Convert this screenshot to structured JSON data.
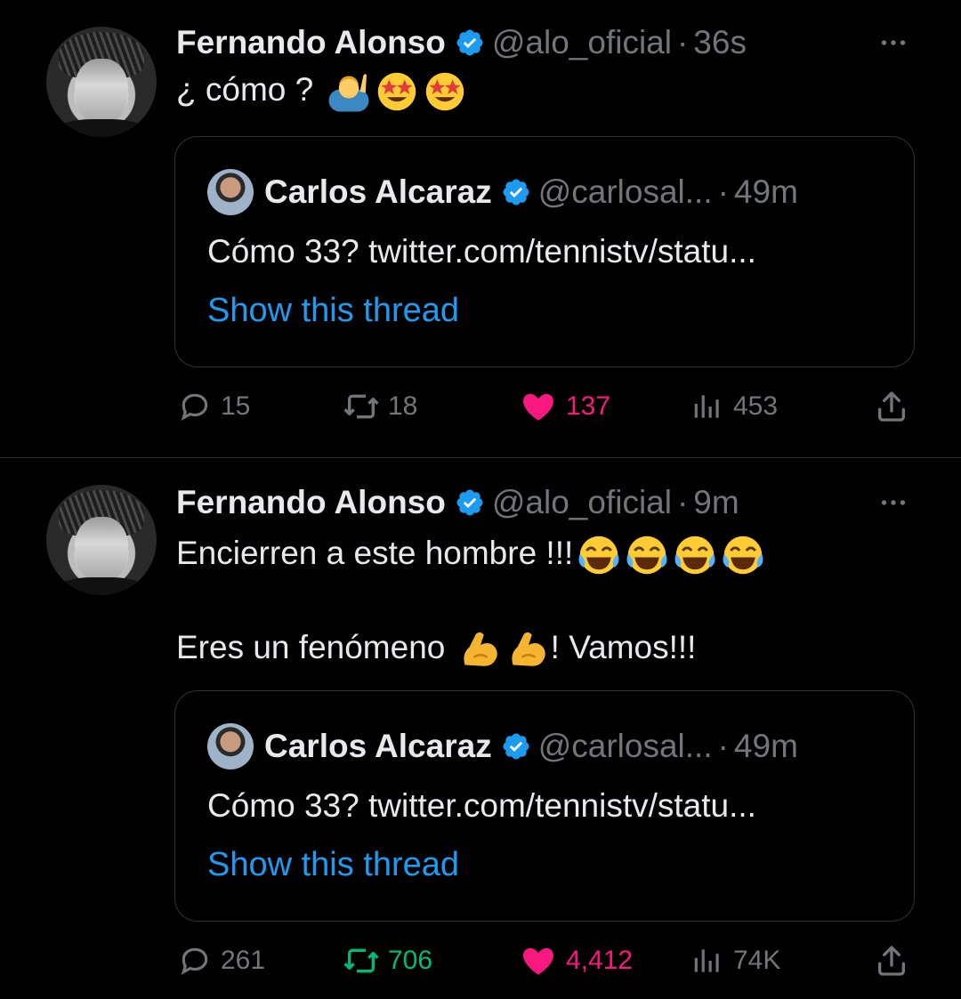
{
  "tweets": [
    {
      "author": "Fernando Alonso",
      "handle": "@alo_oficial",
      "separator": "·",
      "time": "36s",
      "lines": [
        "¿ cómo ?"
      ],
      "emojis": [
        "man-raising-hand-emoji",
        "star-struck-emoji",
        "star-struck-emoji"
      ],
      "quote": {
        "author": "Carlos Alcaraz",
        "handle": "@carlosal...",
        "separator": "·",
        "time": "49m",
        "text": "Cómo 33? twitter.com/tennistv/statu...",
        "link": "Show this thread"
      },
      "stats": {
        "replies": "15",
        "retweets": "18",
        "likes": "137",
        "views": "453"
      },
      "retweeted": false,
      "liked": true
    },
    {
      "author": "Fernando Alonso",
      "handle": "@alo_oficial",
      "separator": "·",
      "time": "9m",
      "lines": [
        "Encierren a este hombre !!!",
        "Eres un fenómeno",
        "! Vamos!!!"
      ],
      "emojis": [
        "laughing-tears-emoji",
        "laughing-tears-emoji",
        "laughing-tears-emoji",
        "laughing-tears-emoji",
        "flexed-biceps-emoji",
        "flexed-biceps-emoji"
      ],
      "quote": {
        "author": "Carlos Alcaraz",
        "handle": "@carlosal...",
        "separator": "·",
        "time": "49m",
        "text": "Cómo 33? twitter.com/tennistv/statu...",
        "link": "Show this thread"
      },
      "stats": {
        "replies": "261",
        "retweets": "706",
        "likes": "4,412",
        "views": "74K"
      },
      "retweeted": true,
      "liked": true
    }
  ],
  "colors": {
    "background": "#000000",
    "text": "#e7e9ea",
    "muted": "#71767b",
    "link": "#1d9bf0",
    "like": "#f91880",
    "retweet": "#00ba7c",
    "border": "#2f3336"
  }
}
